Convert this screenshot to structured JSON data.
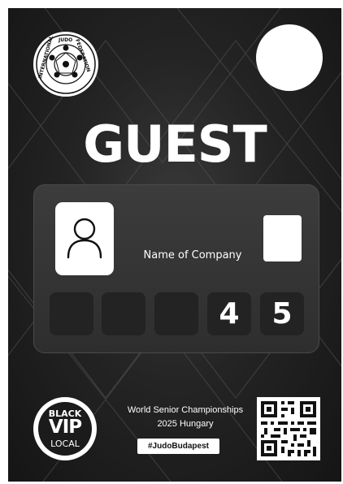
{
  "badge": {
    "role": "GUEST",
    "company_label": "Name of Company",
    "slots": [
      "",
      "",
      "",
      "4",
      "5"
    ],
    "logo": {
      "text_top": "JUDO",
      "text_left": "INTERNATIONAL",
      "text_right": "FEDERATION",
      "icon": "ijf-seal-icon"
    },
    "vip": {
      "line1": "BLACK",
      "line2": "VIP",
      "line3": "LOCAL"
    },
    "event": {
      "line1": "World Senior Championships",
      "line2": "2025 Hungary"
    },
    "hashtag": "#JudoBudapest",
    "colors": {
      "background": "#1f1f1f",
      "panel": "#353535",
      "slot": "#232323",
      "text": "#ffffff"
    }
  }
}
